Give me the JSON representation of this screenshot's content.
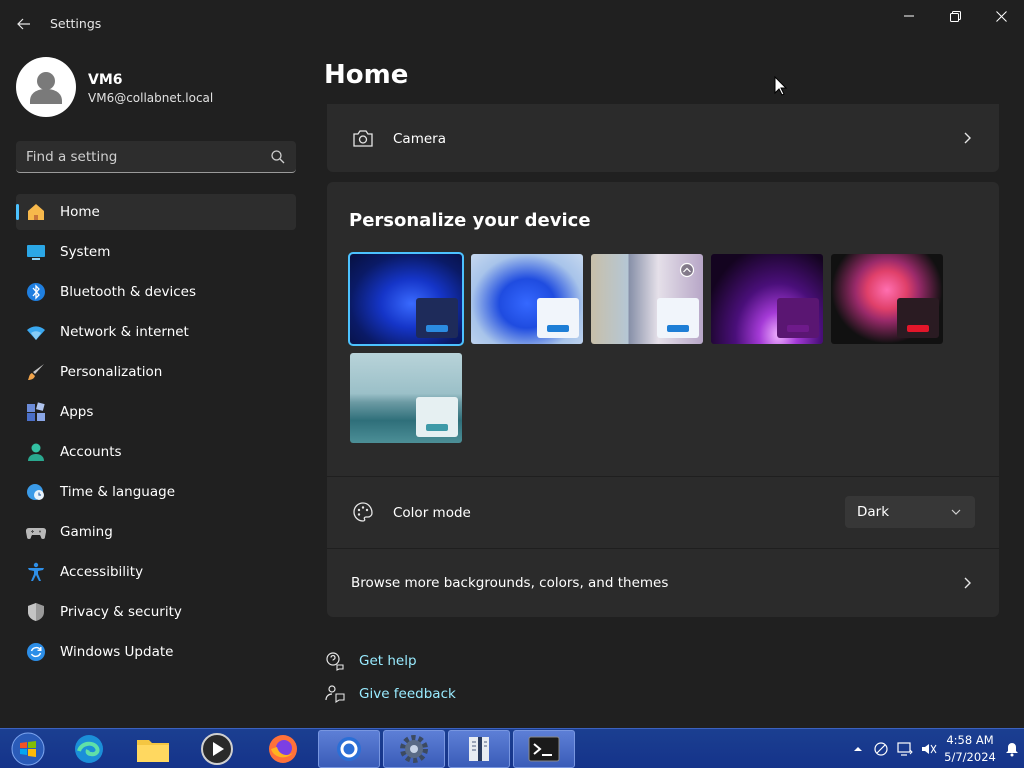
{
  "window": {
    "title": "Settings"
  },
  "profile": {
    "name": "VM6",
    "email": "VM6@collabnet.local"
  },
  "search": {
    "placeholder": "Find a setting"
  },
  "sidebar": {
    "items": [
      {
        "label": "Home",
        "icon": "home-icon",
        "selected": true
      },
      {
        "label": "System",
        "icon": "system-icon"
      },
      {
        "label": "Bluetooth & devices",
        "icon": "bluetooth-icon"
      },
      {
        "label": "Network & internet",
        "icon": "wifi-icon"
      },
      {
        "label": "Personalization",
        "icon": "brush-icon"
      },
      {
        "label": "Apps",
        "icon": "apps-icon"
      },
      {
        "label": "Accounts",
        "icon": "accounts-icon"
      },
      {
        "label": "Time & language",
        "icon": "globe-clock-icon"
      },
      {
        "label": "Gaming",
        "icon": "gamepad-icon"
      },
      {
        "label": "Accessibility",
        "icon": "accessibility-icon"
      },
      {
        "label": "Privacy & security",
        "icon": "shield-icon"
      },
      {
        "label": "Windows Update",
        "icon": "update-icon"
      }
    ]
  },
  "main": {
    "title": "Home",
    "camera_label": "Camera",
    "personalize_title": "Personalize your device",
    "color_mode_label": "Color mode",
    "color_mode_value": "Dark",
    "browse_label": "Browse more backgrounds, colors, and themes",
    "help_label": "Get help",
    "feedback_label": "Give feedback"
  },
  "themes": [
    {
      "name": "bloom-dark",
      "selected": true
    },
    {
      "name": "bloom-light"
    },
    {
      "name": "spotlight"
    },
    {
      "name": "glow"
    },
    {
      "name": "captured-motion"
    },
    {
      "name": "flow"
    }
  ],
  "colors": {
    "accent": "#4cc2ff",
    "link": "#99ebff",
    "background": "#202020",
    "card": "#2b2b2b"
  },
  "taskbar": {
    "time": "4:58 AM",
    "date": "5/7/2024"
  }
}
